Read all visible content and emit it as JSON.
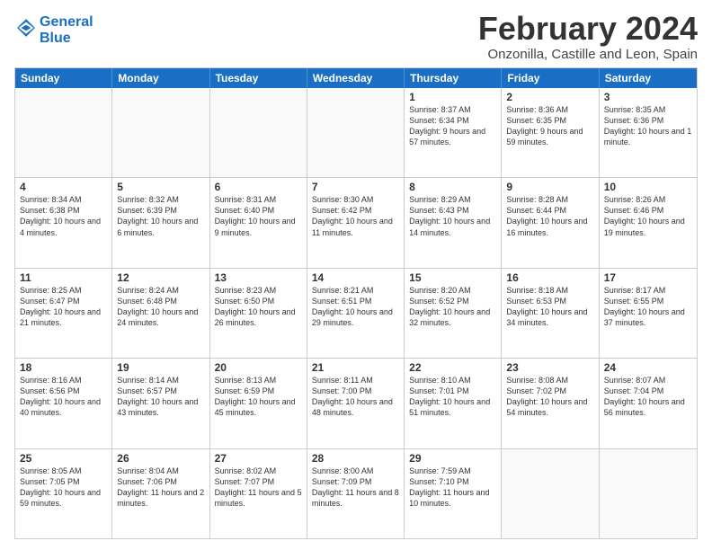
{
  "logo": {
    "line1": "General",
    "line2": "Blue"
  },
  "title": "February 2024",
  "location": "Onzonilla, Castille and Leon, Spain",
  "days": [
    "Sunday",
    "Monday",
    "Tuesday",
    "Wednesday",
    "Thursday",
    "Friday",
    "Saturday"
  ],
  "weeks": [
    [
      {
        "day": "",
        "info": ""
      },
      {
        "day": "",
        "info": ""
      },
      {
        "day": "",
        "info": ""
      },
      {
        "day": "",
        "info": ""
      },
      {
        "day": "1",
        "sunrise": "Sunrise: 8:37 AM",
        "sunset": "Sunset: 6:34 PM",
        "daylight": "Daylight: 9 hours and 57 minutes."
      },
      {
        "day": "2",
        "sunrise": "Sunrise: 8:36 AM",
        "sunset": "Sunset: 6:35 PM",
        "daylight": "Daylight: 9 hours and 59 minutes."
      },
      {
        "day": "3",
        "sunrise": "Sunrise: 8:35 AM",
        "sunset": "Sunset: 6:36 PM",
        "daylight": "Daylight: 10 hours and 1 minute."
      }
    ],
    [
      {
        "day": "4",
        "sunrise": "Sunrise: 8:34 AM",
        "sunset": "Sunset: 6:38 PM",
        "daylight": "Daylight: 10 hours and 4 minutes."
      },
      {
        "day": "5",
        "sunrise": "Sunrise: 8:32 AM",
        "sunset": "Sunset: 6:39 PM",
        "daylight": "Daylight: 10 hours and 6 minutes."
      },
      {
        "day": "6",
        "sunrise": "Sunrise: 8:31 AM",
        "sunset": "Sunset: 6:40 PM",
        "daylight": "Daylight: 10 hours and 9 minutes."
      },
      {
        "day": "7",
        "sunrise": "Sunrise: 8:30 AM",
        "sunset": "Sunset: 6:42 PM",
        "daylight": "Daylight: 10 hours and 11 minutes."
      },
      {
        "day": "8",
        "sunrise": "Sunrise: 8:29 AM",
        "sunset": "Sunset: 6:43 PM",
        "daylight": "Daylight: 10 hours and 14 minutes."
      },
      {
        "day": "9",
        "sunrise": "Sunrise: 8:28 AM",
        "sunset": "Sunset: 6:44 PM",
        "daylight": "Daylight: 10 hours and 16 minutes."
      },
      {
        "day": "10",
        "sunrise": "Sunrise: 8:26 AM",
        "sunset": "Sunset: 6:46 PM",
        "daylight": "Daylight: 10 hours and 19 minutes."
      }
    ],
    [
      {
        "day": "11",
        "sunrise": "Sunrise: 8:25 AM",
        "sunset": "Sunset: 6:47 PM",
        "daylight": "Daylight: 10 hours and 21 minutes."
      },
      {
        "day": "12",
        "sunrise": "Sunrise: 8:24 AM",
        "sunset": "Sunset: 6:48 PM",
        "daylight": "Daylight: 10 hours and 24 minutes."
      },
      {
        "day": "13",
        "sunrise": "Sunrise: 8:23 AM",
        "sunset": "Sunset: 6:50 PM",
        "daylight": "Daylight: 10 hours and 26 minutes."
      },
      {
        "day": "14",
        "sunrise": "Sunrise: 8:21 AM",
        "sunset": "Sunset: 6:51 PM",
        "daylight": "Daylight: 10 hours and 29 minutes."
      },
      {
        "day": "15",
        "sunrise": "Sunrise: 8:20 AM",
        "sunset": "Sunset: 6:52 PM",
        "daylight": "Daylight: 10 hours and 32 minutes."
      },
      {
        "day": "16",
        "sunrise": "Sunrise: 8:18 AM",
        "sunset": "Sunset: 6:53 PM",
        "daylight": "Daylight: 10 hours and 34 minutes."
      },
      {
        "day": "17",
        "sunrise": "Sunrise: 8:17 AM",
        "sunset": "Sunset: 6:55 PM",
        "daylight": "Daylight: 10 hours and 37 minutes."
      }
    ],
    [
      {
        "day": "18",
        "sunrise": "Sunrise: 8:16 AM",
        "sunset": "Sunset: 6:56 PM",
        "daylight": "Daylight: 10 hours and 40 minutes."
      },
      {
        "day": "19",
        "sunrise": "Sunrise: 8:14 AM",
        "sunset": "Sunset: 6:57 PM",
        "daylight": "Daylight: 10 hours and 43 minutes."
      },
      {
        "day": "20",
        "sunrise": "Sunrise: 8:13 AM",
        "sunset": "Sunset: 6:59 PM",
        "daylight": "Daylight: 10 hours and 45 minutes."
      },
      {
        "day": "21",
        "sunrise": "Sunrise: 8:11 AM",
        "sunset": "Sunset: 7:00 PM",
        "daylight": "Daylight: 10 hours and 48 minutes."
      },
      {
        "day": "22",
        "sunrise": "Sunrise: 8:10 AM",
        "sunset": "Sunset: 7:01 PM",
        "daylight": "Daylight: 10 hours and 51 minutes."
      },
      {
        "day": "23",
        "sunrise": "Sunrise: 8:08 AM",
        "sunset": "Sunset: 7:02 PM",
        "daylight": "Daylight: 10 hours and 54 minutes."
      },
      {
        "day": "24",
        "sunrise": "Sunrise: 8:07 AM",
        "sunset": "Sunset: 7:04 PM",
        "daylight": "Daylight: 10 hours and 56 minutes."
      }
    ],
    [
      {
        "day": "25",
        "sunrise": "Sunrise: 8:05 AM",
        "sunset": "Sunset: 7:05 PM",
        "daylight": "Daylight: 10 hours and 59 minutes."
      },
      {
        "day": "26",
        "sunrise": "Sunrise: 8:04 AM",
        "sunset": "Sunset: 7:06 PM",
        "daylight": "Daylight: 11 hours and 2 minutes."
      },
      {
        "day": "27",
        "sunrise": "Sunrise: 8:02 AM",
        "sunset": "Sunset: 7:07 PM",
        "daylight": "Daylight: 11 hours and 5 minutes."
      },
      {
        "day": "28",
        "sunrise": "Sunrise: 8:00 AM",
        "sunset": "Sunset: 7:09 PM",
        "daylight": "Daylight: 11 hours and 8 minutes."
      },
      {
        "day": "29",
        "sunrise": "Sunrise: 7:59 AM",
        "sunset": "Sunset: 7:10 PM",
        "daylight": "Daylight: 11 hours and 10 minutes."
      },
      {
        "day": "",
        "info": ""
      },
      {
        "day": "",
        "info": ""
      }
    ]
  ]
}
